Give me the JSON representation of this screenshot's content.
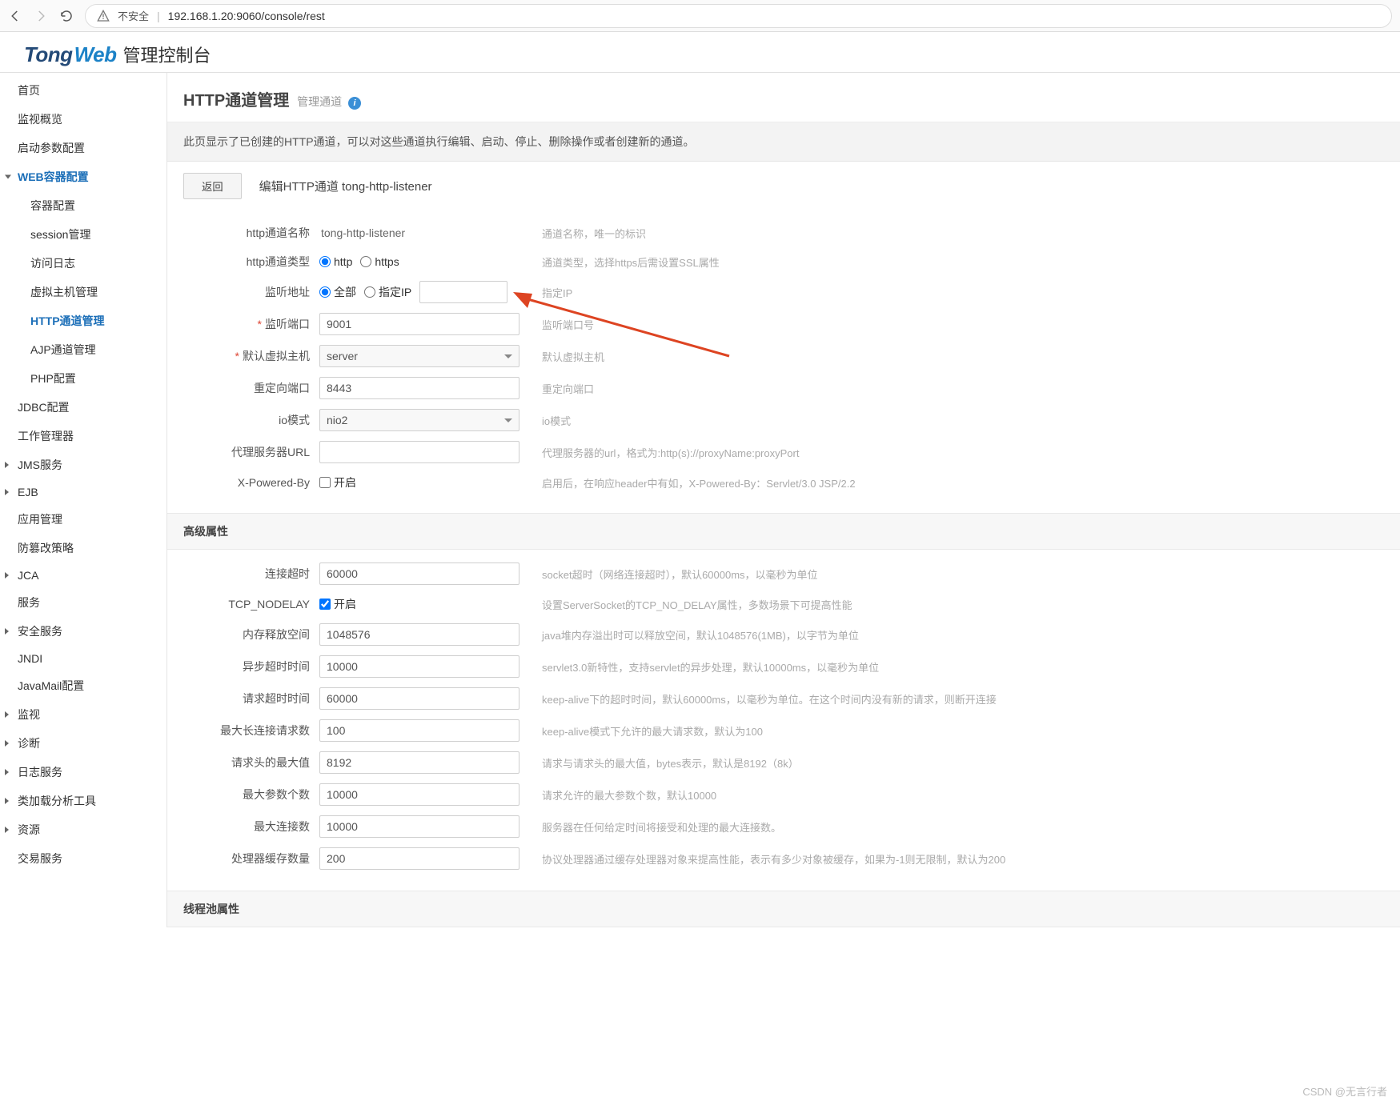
{
  "browser": {
    "insecure_label": "不安全",
    "url": "192.168.1.20:9060/console/rest"
  },
  "logo": {
    "tong": "Tong",
    "web": "Web",
    "cn": "管理控制台"
  },
  "sidebar": [
    {
      "label": "首页",
      "level": 1
    },
    {
      "label": "监视概览",
      "level": 1
    },
    {
      "label": "启动参数配置",
      "level": 1
    },
    {
      "label": "WEB容器配置",
      "level": 1,
      "expanded": true,
      "bold": true
    },
    {
      "label": "容器配置",
      "level": 2
    },
    {
      "label": "session管理",
      "level": 2
    },
    {
      "label": "访问日志",
      "level": 2
    },
    {
      "label": "虚拟主机管理",
      "level": 2
    },
    {
      "label": "HTTP通道管理",
      "level": 2,
      "active": true
    },
    {
      "label": "AJP通道管理",
      "level": 2
    },
    {
      "label": "PHP配置",
      "level": 2
    },
    {
      "label": "JDBC配置",
      "level": 1
    },
    {
      "label": "工作管理器",
      "level": 1
    },
    {
      "label": "JMS服务",
      "level": 1,
      "arrow": true
    },
    {
      "label": "EJB",
      "level": 1,
      "arrow": true
    },
    {
      "label": "应用管理",
      "level": 1
    },
    {
      "label": "防篡改策略",
      "level": 1
    },
    {
      "label": "JCA",
      "level": 1,
      "arrow": true
    },
    {
      "label": "服务",
      "level": 1
    },
    {
      "label": "安全服务",
      "level": 1,
      "arrow": true
    },
    {
      "label": "JNDI",
      "level": 1
    },
    {
      "label": "JavaMail配置",
      "level": 1
    },
    {
      "label": "监视",
      "level": 1,
      "arrow": true
    },
    {
      "label": "诊断",
      "level": 1,
      "arrow": true
    },
    {
      "label": "日志服务",
      "level": 1,
      "arrow": true
    },
    {
      "label": "类加载分析工具",
      "level": 1,
      "arrow": true
    },
    {
      "label": "资源",
      "level": 1,
      "arrow": true
    },
    {
      "label": "交易服务",
      "level": 1
    }
  ],
  "page": {
    "title": "HTTP通道管理",
    "subtitle": "管理通道",
    "description": "此页显示了已创建的HTTP通道，可以对这些通道执行编辑、启动、停止、删除操作或者创建新的通道。",
    "back_button": "返回",
    "edit_title": "编辑HTTP通道 tong-http-listener"
  },
  "form_basic": [
    {
      "label": "http通道名称",
      "type": "static",
      "value": "tong-http-listener",
      "hint": "通道名称，唯一的标识"
    },
    {
      "label": "http通道类型",
      "type": "radio2",
      "opt1": "http",
      "opt2": "https",
      "checked": 1,
      "hint": "通道类型，选择https后需设置SSL属性"
    },
    {
      "label": "监听地址",
      "type": "radio_ip",
      "opt1": "全部",
      "opt2": "指定IP",
      "checked": 1,
      "hint": "指定IP"
    },
    {
      "label": "监听端口",
      "type": "text",
      "value": "9001",
      "required": true,
      "hint": "监听端口号"
    },
    {
      "label": "默认虚拟主机",
      "type": "select",
      "value": "server",
      "required": true,
      "hint": "默认虚拟主机"
    },
    {
      "label": "重定向端口",
      "type": "text",
      "value": "8443",
      "hint": "重定向端口"
    },
    {
      "label": "io模式",
      "type": "select",
      "value": "nio2",
      "hint": "io模式"
    },
    {
      "label": "代理服务器URL",
      "type": "text",
      "value": "",
      "hint": "代理服务器的url，格式为:http(s)://proxyName:proxyPort"
    },
    {
      "label": "X-Powered-By",
      "type": "checkbox",
      "cblabel": "开启",
      "checked": false,
      "hint": "启用后，在响应header中有如，X-Powered-By：Servlet/3.0 JSP/2.2"
    }
  ],
  "section_adv": "高级属性",
  "form_adv": [
    {
      "label": "连接超时",
      "type": "text",
      "value": "60000",
      "hint": "socket超时（网络连接超时），默认60000ms，以毫秒为单位"
    },
    {
      "label": "TCP_NODELAY",
      "type": "checkbox",
      "cblabel": "开启",
      "checked": true,
      "hint": "设置ServerSocket的TCP_NO_DELAY属性，多数场景下可提高性能"
    },
    {
      "label": "内存释放空间",
      "type": "text",
      "value": "1048576",
      "hint": "java堆内存溢出时可以释放空间，默认1048576(1MB)，以字节为单位"
    },
    {
      "label": "异步超时时间",
      "type": "text",
      "value": "10000",
      "hint": "servlet3.0新特性，支持servlet的异步处理，默认10000ms，以毫秒为单位"
    },
    {
      "label": "请求超时时间",
      "type": "text",
      "value": "60000",
      "hint": "keep-alive下的超时时间，默认60000ms，以毫秒为单位。在这个时间内没有新的请求，则断开连接"
    },
    {
      "label": "最大长连接请求数",
      "type": "text",
      "value": "100",
      "hint": "keep-alive模式下允许的最大请求数，默认为100"
    },
    {
      "label": "请求头的最大值",
      "type": "text",
      "value": "8192",
      "hint": "请求与请求头的最大值，bytes表示，默认是8192（8k）"
    },
    {
      "label": "最大参数个数",
      "type": "text",
      "value": "10000",
      "hint": "请求允许的最大参数个数，默认10000"
    },
    {
      "label": "最大连接数",
      "type": "text",
      "value": "10000",
      "hint": "服务器在任何给定时间将接受和处理的最大连接数。"
    },
    {
      "label": "处理器缓存数量",
      "type": "text",
      "value": "200",
      "hint": "协议处理器通过缓存处理器对象来提高性能，表示有多少对象被缓存，如果为-1则无限制，默认为200"
    }
  ],
  "section_thread": "线程池属性",
  "watermark": "CSDN @无言行者"
}
